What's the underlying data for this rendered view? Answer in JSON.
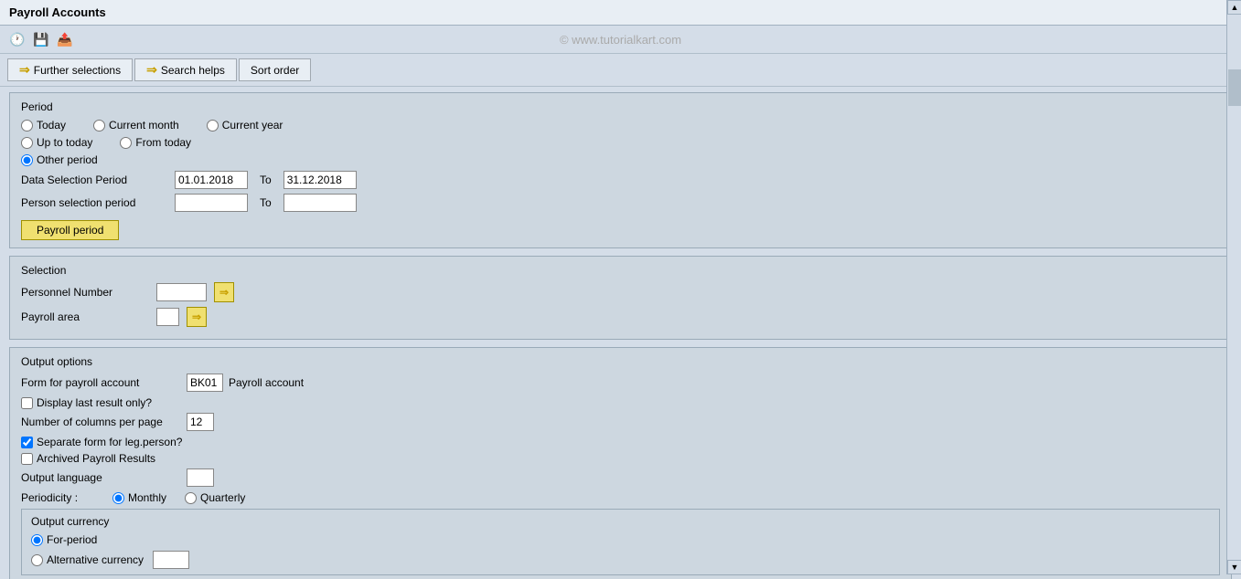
{
  "title": "Payroll Accounts",
  "toolbar": {
    "icons": [
      "clock",
      "save",
      "export"
    ],
    "watermark": "© www.tutorialkart.com"
  },
  "tabs": [
    {
      "label": "Further selections",
      "arrow": true
    },
    {
      "label": "Search helps",
      "arrow": true
    },
    {
      "label": "Sort order",
      "arrow": false
    }
  ],
  "period_section": {
    "title": "Period",
    "radios_row1": [
      {
        "id": "today",
        "label": "Today",
        "checked": false
      },
      {
        "id": "current_month",
        "label": "Current month",
        "checked": false
      },
      {
        "id": "current_year",
        "label": "Current year",
        "checked": false
      }
    ],
    "radios_row2": [
      {
        "id": "up_to_today",
        "label": "Up to today",
        "checked": false
      },
      {
        "id": "from_today",
        "label": "From today",
        "checked": false
      }
    ],
    "other_period": {
      "id": "other_period",
      "label": "Other period",
      "checked": true
    },
    "data_selection_period": {
      "label": "Data Selection Period",
      "from_value": "01.01.2018",
      "to_label": "To",
      "to_value": "31.12.2018"
    },
    "person_selection_period": {
      "label": "Person selection period",
      "from_value": "",
      "to_label": "To",
      "to_value": ""
    },
    "payroll_period_btn": "Payroll period"
  },
  "selection_section": {
    "title": "Selection",
    "personnel_number": {
      "label": "Personnel Number",
      "value": ""
    },
    "payroll_area": {
      "label": "Payroll area",
      "value": ""
    }
  },
  "output_section": {
    "title": "Output options",
    "form_for_payroll": {
      "label": "Form for payroll account",
      "code_value": "BK01",
      "text_value": "Payroll account"
    },
    "display_last_result": {
      "label": "Display last result only?",
      "checked": false
    },
    "columns_per_page": {
      "label": "Number of columns per page",
      "value": "12"
    },
    "separate_form": {
      "label": "Separate form for leg.person?",
      "checked": true
    },
    "archived_payroll": {
      "label": "Archived Payroll Results",
      "checked": false
    },
    "output_language": {
      "label": "Output language",
      "value": ""
    },
    "periodicity": {
      "label": "Periodicity :",
      "monthly": {
        "label": "Monthly",
        "checked": true
      },
      "quarterly": {
        "label": "Quarterly",
        "checked": false
      }
    },
    "output_currency": {
      "title": "Output currency",
      "for_period": {
        "label": "For-period",
        "checked": true
      },
      "alternative_currency": {
        "label": "Alternative currency",
        "checked": false,
        "value": ""
      }
    }
  }
}
